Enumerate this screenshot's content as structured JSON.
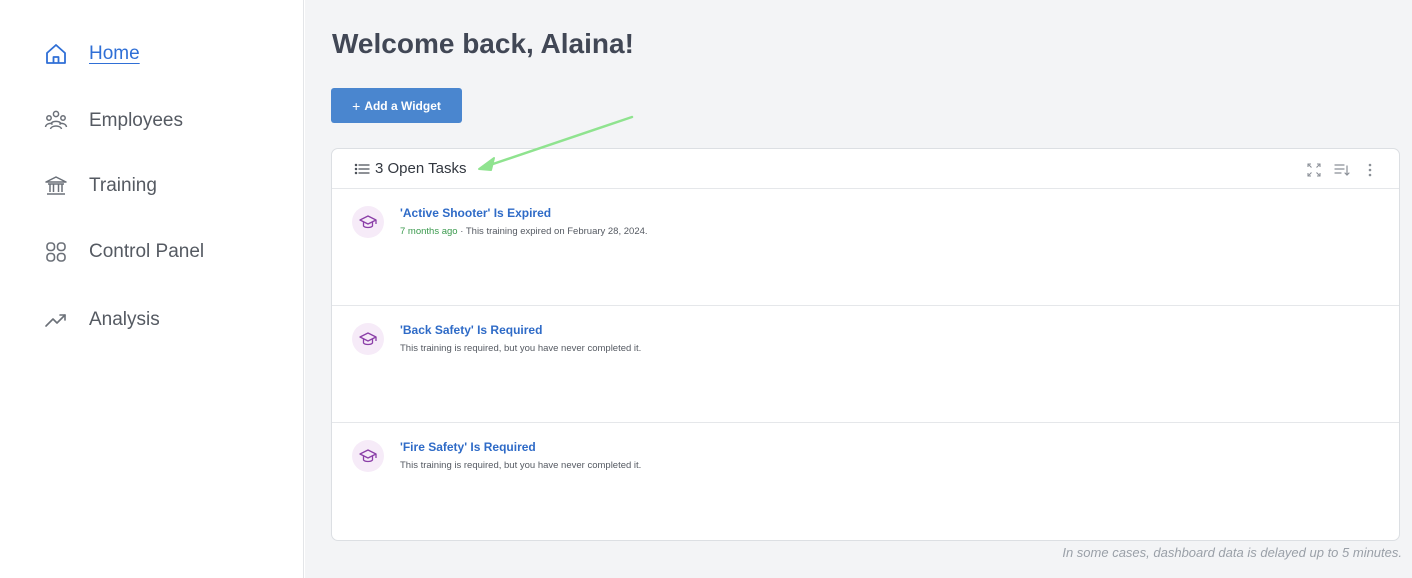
{
  "sidebar": {
    "items": [
      {
        "label": "Home",
        "icon": "home-icon",
        "active": true
      },
      {
        "label": "Employees",
        "icon": "people-icon",
        "active": false
      },
      {
        "label": "Training",
        "icon": "institution-icon",
        "active": false
      },
      {
        "label": "Control Panel",
        "icon": "grid-icon",
        "active": false
      },
      {
        "label": "Analysis",
        "icon": "trend-icon",
        "active": false
      }
    ]
  },
  "main": {
    "title": "Welcome back, Alaina!",
    "add_widget": {
      "plus": "+",
      "label": "Add a Widget"
    },
    "tasks_card": {
      "title": "3 Open Tasks",
      "tasks": [
        {
          "title": "'Active Shooter' Is Expired",
          "ago": "7 months ago",
          "separator": " · ",
          "detail": "This training expired on February 28, 2024."
        },
        {
          "title": "'Back Safety' Is Required",
          "ago": "",
          "separator": "",
          "detail": "This training is required, but you have never completed it."
        },
        {
          "title": "'Fire Safety' Is Required",
          "ago": "",
          "separator": "",
          "detail": "This training is required, but you have never completed it."
        }
      ]
    },
    "footnote": "In some cases, dashboard data is delayed up to 5 minutes."
  },
  "colors": {
    "accent": "#4a86cf",
    "link": "#2f6bc7",
    "time_green": "#3b9a4e",
    "annotation_arrow": "#8fe38f"
  }
}
